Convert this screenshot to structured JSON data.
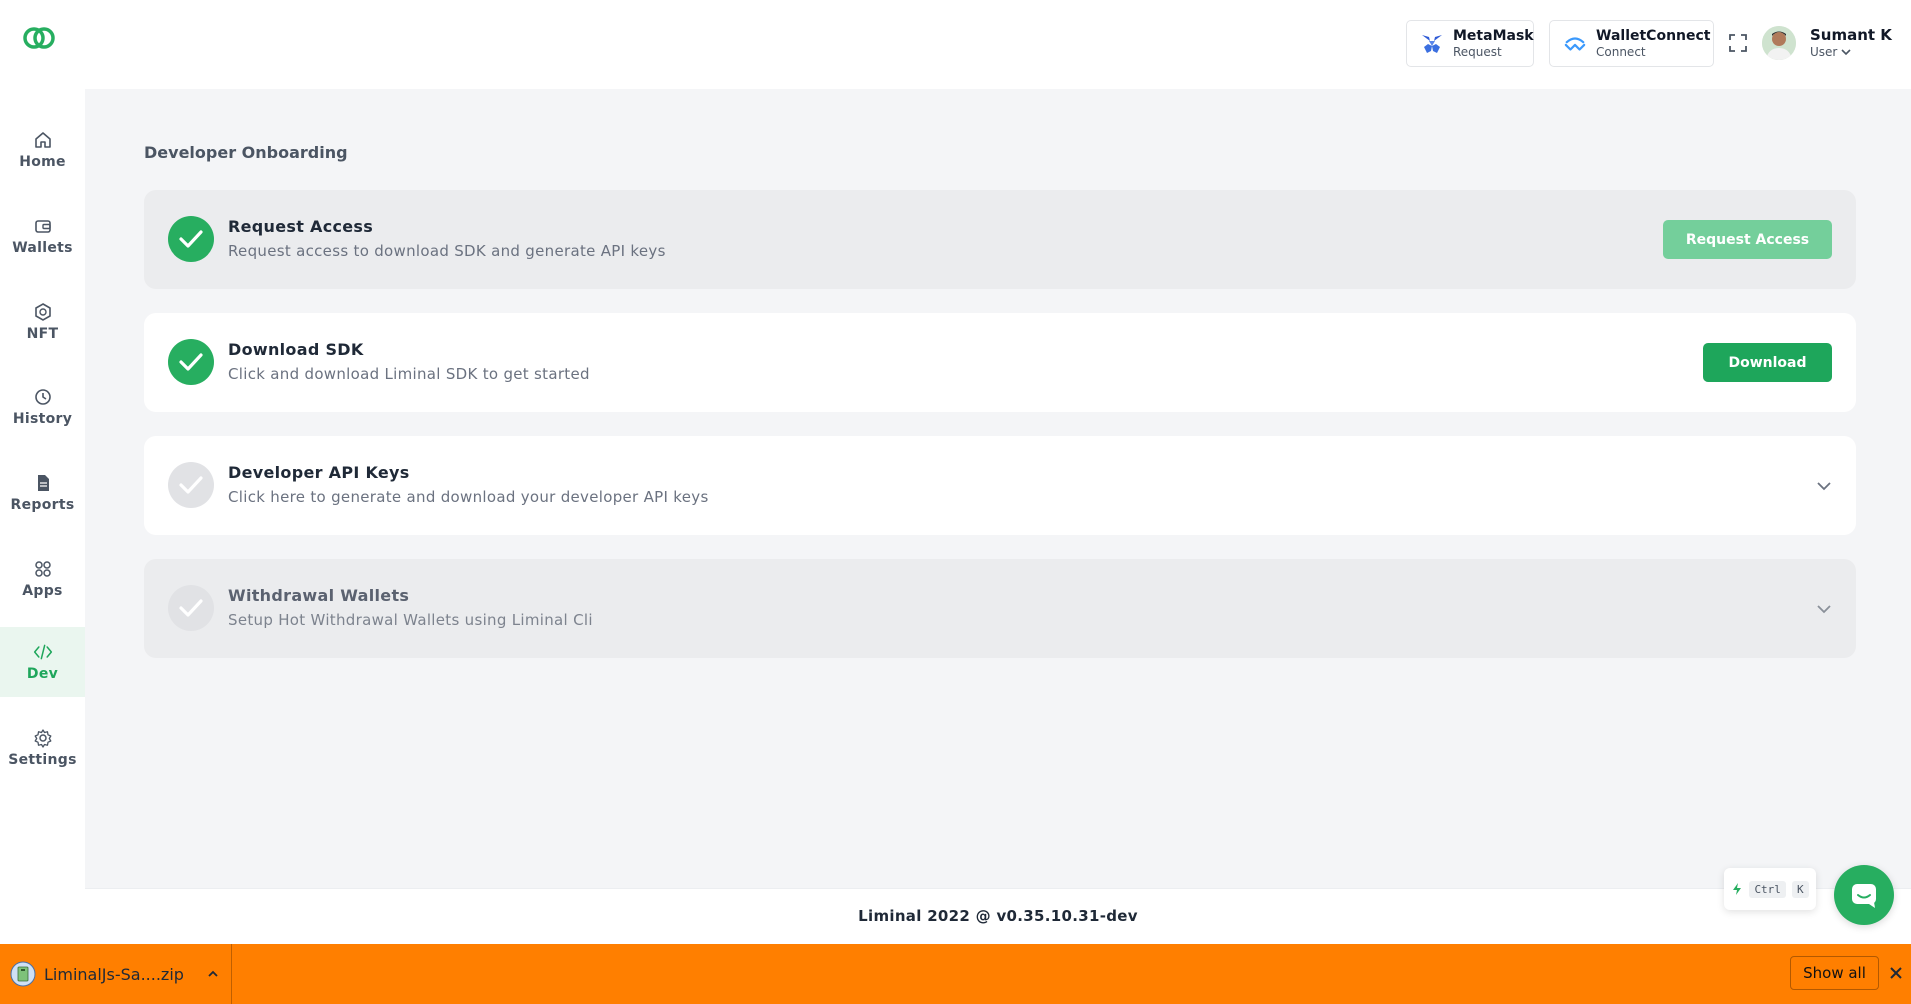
{
  "header": {
    "metamask": {
      "name": "MetaMask",
      "sub": "Request"
    },
    "walletconnect": {
      "name": "WalletConnect",
      "sub": "Connect"
    },
    "user": {
      "name": "Sumant K",
      "role": "User"
    }
  },
  "sidebar": {
    "items": [
      {
        "label": "Home",
        "icon": "home-icon"
      },
      {
        "label": "Wallets",
        "icon": "wallet-icon"
      },
      {
        "label": "NFT",
        "icon": "nft-icon"
      },
      {
        "label": "History",
        "icon": "clock-icon"
      },
      {
        "label": "Reports",
        "icon": "document-icon"
      },
      {
        "label": "Apps",
        "icon": "apps-grid-icon"
      },
      {
        "label": "Dev",
        "icon": "code-icon",
        "active": true
      },
      {
        "label": "Settings",
        "icon": "gear-icon"
      }
    ]
  },
  "main": {
    "title": "Developer Onboarding",
    "steps": [
      {
        "title": "Request Access",
        "desc": "Request access to download SDK and generate API keys",
        "status": "done",
        "button": "Request Access"
      },
      {
        "title": "Download SDK",
        "desc": "Click and download Liminal SDK to get started",
        "status": "done",
        "button": "Download"
      },
      {
        "title": "Developer API Keys",
        "desc": "Click here to generate and download your developer API keys",
        "status": "pending"
      },
      {
        "title": "Withdrawal Wallets",
        "desc": "Setup Hot Withdrawal Wallets using Liminal Cli",
        "status": "pending"
      }
    ]
  },
  "footer": {
    "text": "Liminal 2022 @ v0.35.10.31-dev"
  },
  "shortcut": {
    "key1": "Ctrl",
    "key2": "K"
  },
  "download_bar": {
    "file": "LiminalJs-Sa....zip",
    "show_all": "Show all"
  },
  "colors": {
    "brand": "#1ea65b",
    "brand_light": "#74cf9b",
    "download_bar": "#ff7f00"
  }
}
